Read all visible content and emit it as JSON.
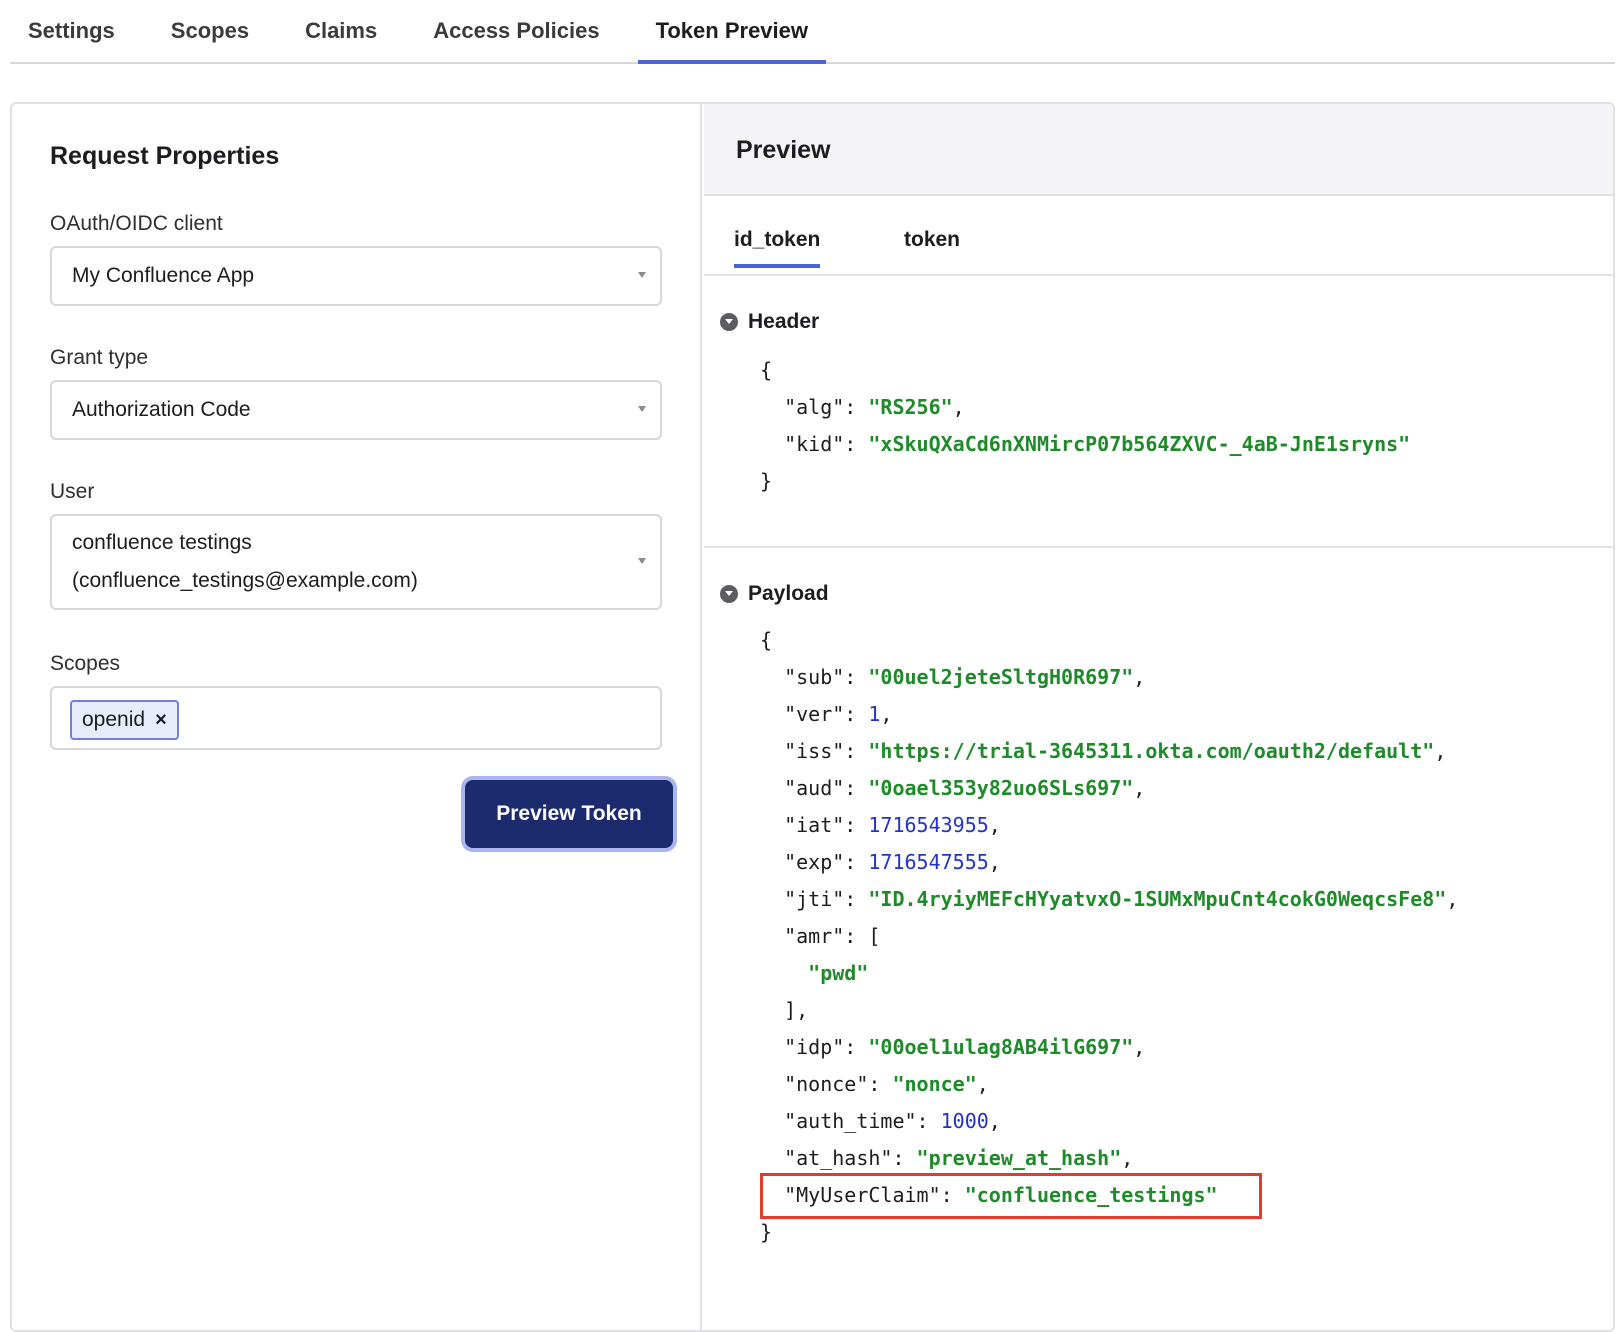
{
  "nav": {
    "tabs": [
      "Settings",
      "Scopes",
      "Claims",
      "Access Policies",
      "Token Preview"
    ],
    "active": "Token Preview"
  },
  "request": {
    "title": "Request Properties",
    "client_label": "OAuth/OIDC client",
    "client_value": "My Confluence App",
    "grant_label": "Grant type",
    "grant_value": "Authorization Code",
    "user_label": "User",
    "user_line1": "confluence testings",
    "user_line2": "(confluence_testings@example.com)",
    "scopes_label": "Scopes",
    "scope_chip": "openid",
    "chip_remove": "×",
    "preview_button": "Preview Token"
  },
  "preview": {
    "title": "Preview",
    "tabs": [
      "id_token",
      "token"
    ],
    "active_tab": "id_token",
    "header_title": "Header",
    "payload_title": "Payload",
    "header": {
      "alg": "RS256",
      "kid": "xSkuQXaCd6nXNMircP07b564ZXVC-_4aB-JnE1sryns"
    },
    "payload": {
      "sub": "00uel2jeteSltgH0R697",
      "ver": 1,
      "iss": "https://trial-3645311.okta.com/oauth2/default",
      "aud": "0oael353y82uo6SLs697",
      "iat": 1716543955,
      "exp": 1716547555,
      "jti": "ID.4ryiyMEFcHYyatvxO-1SUMxMpuCnt4cokG0WeqcsFe8",
      "amr": [
        "pwd"
      ],
      "idp": "00oel1ulag8AB4ilG697",
      "nonce": "nonce",
      "auth_time": 1000,
      "at_hash": "preview_at_hash",
      "MyUserClaim": "confluence_testings"
    }
  },
  "colors": {
    "accent": "#4c64d9",
    "button": "#1c2a6e",
    "string": "#1f8a2a",
    "number": "#2233cc",
    "highlight": "#e53b2c"
  }
}
